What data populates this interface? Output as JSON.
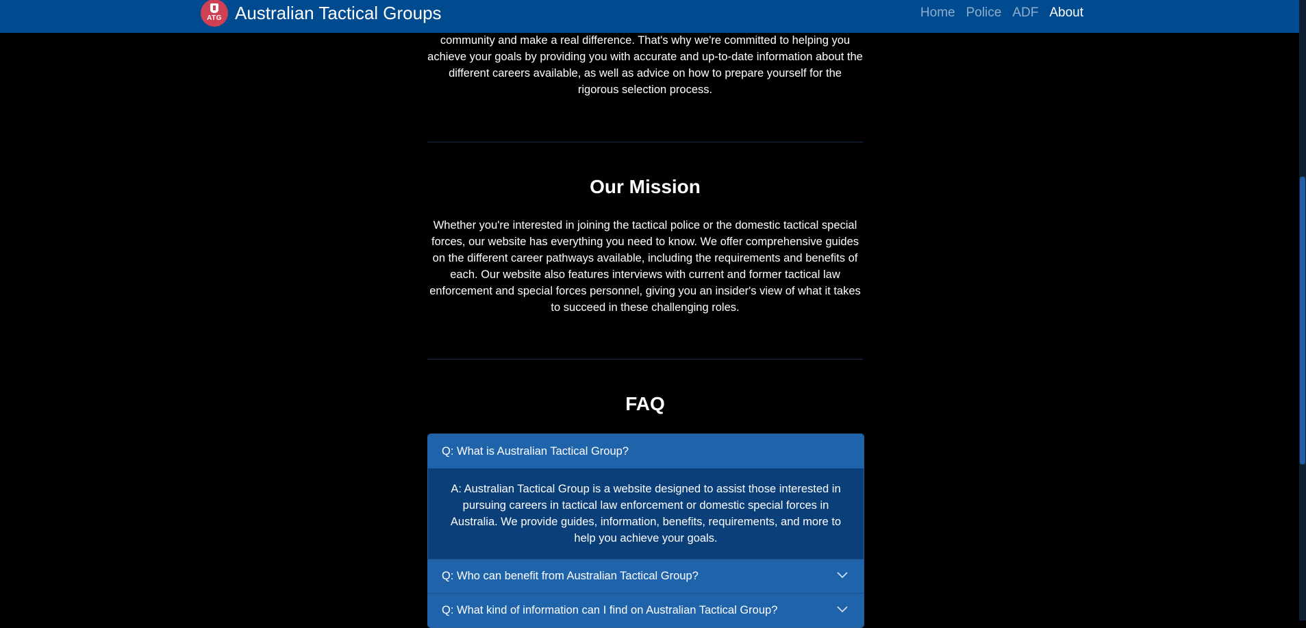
{
  "navbar": {
    "logo_text": "ATG",
    "brand": "Australian Tactical Groups",
    "links": [
      {
        "label": "Home",
        "active": false
      },
      {
        "label": "Police",
        "active": false
      },
      {
        "label": "ADF",
        "active": false
      },
      {
        "label": "About",
        "active": true
      }
    ]
  },
  "intro": {
    "text": "community and make a real difference. That's why we're committed to helping you achieve your goals by providing you with accurate and up-to-date information about the different careers available, as well as advice on how to prepare yourself for the rigorous selection process."
  },
  "mission": {
    "title": "Our Mission",
    "text": "Whether you're interested in joining the tactical police or the domestic tactical special forces, our website has everything you need to know. We offer comprehensive guides on the different career pathways available, including the requirements and benefits of each. Our website also features interviews with current and former tactical law enforcement and special forces personnel, giving you an insider's view of what it takes to succeed in these challenging roles."
  },
  "faq": {
    "title": "FAQ",
    "items": [
      {
        "question": "Q: What is Australian Tactical Group?",
        "answer": "A: Australian Tactical Group is a website designed to assist those interested in pursuing careers in tactical law enforcement or domestic special forces in Australia. We provide guides, information, benefits, requirements, and more to help you achieve your goals.",
        "expanded": true
      },
      {
        "question": "Q: Who can benefit from Australian Tactical Group?",
        "expanded": false
      },
      {
        "question": "Q: What kind of information can I find on Australian Tactical Group?",
        "expanded": false
      }
    ]
  },
  "colors": {
    "navbar": "#004b8f",
    "accordion_header": "#1f63ab",
    "accordion_body": "#0a3f7a",
    "logo": "#d04055"
  }
}
